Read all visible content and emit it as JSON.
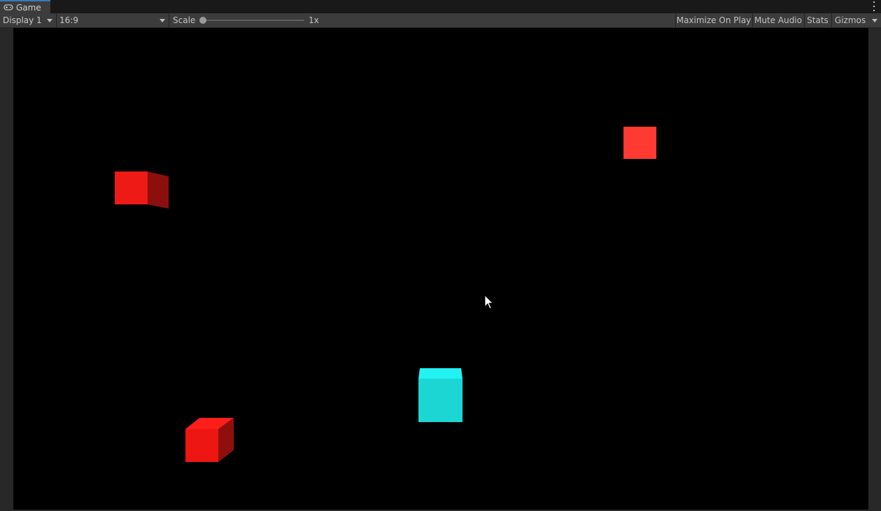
{
  "tab": {
    "title": "Game",
    "icon": "gamepad-icon"
  },
  "toolbar": {
    "display": "Display 1",
    "aspect": "16:9",
    "scale_label": "Scale",
    "scale_value": "1x",
    "scale_fraction": 0.0,
    "maximize_on_play": "Maximize On Play",
    "mute_audio": "Mute Audio",
    "stats": "Stats",
    "gizmos": "Gizmos"
  },
  "scene": {
    "background": "#000000",
    "objects": [
      {
        "name": "red-cube-1",
        "color": "#e81614"
      },
      {
        "name": "red-cube-2",
        "color": "#ff3a33"
      },
      {
        "name": "red-cube-3",
        "color": "#e81614"
      },
      {
        "name": "cyan-cube",
        "color": "#1cd6d3"
      }
    ]
  }
}
